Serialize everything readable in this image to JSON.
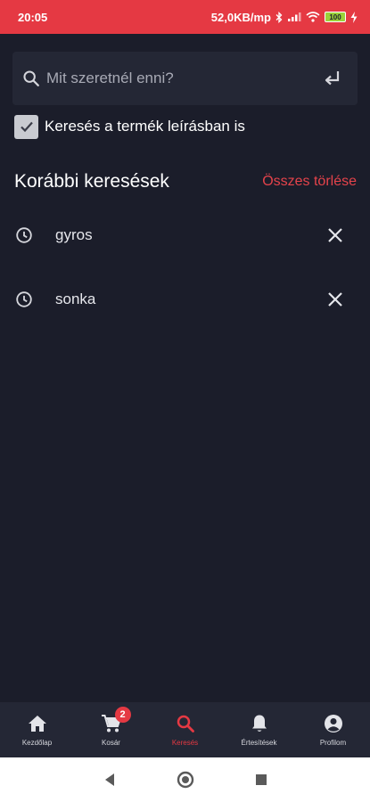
{
  "status_bar": {
    "time": "20:05",
    "network_speed": "52,0KB/mp",
    "battery_level": "100",
    "icons": [
      "bluetooth-icon",
      "signal-icon",
      "wifi-icon",
      "battery-icon",
      "charging-icon"
    ]
  },
  "search": {
    "placeholder": "Mit szeretnél enni?",
    "value": ""
  },
  "description_search": {
    "label": "Keresés a termék leírásban is",
    "checked": true
  },
  "history": {
    "title": "Korábbi keresések",
    "clear_all_label": "Összes törlése",
    "items": [
      {
        "text": "gyros"
      },
      {
        "text": "sonka"
      }
    ]
  },
  "bottom_nav": {
    "active": "search",
    "items": [
      {
        "key": "home",
        "label": "Kezdőlap",
        "icon": "home-icon"
      },
      {
        "key": "cart",
        "label": "Kosár",
        "icon": "cart-icon",
        "badge": "2"
      },
      {
        "key": "search",
        "label": "Keresés",
        "icon": "search-icon"
      },
      {
        "key": "notifications",
        "label": "Értesítések",
        "icon": "bell-icon"
      },
      {
        "key": "profile",
        "label": "Profilom",
        "icon": "profile-icon"
      }
    ]
  },
  "colors": {
    "accent": "#e53943",
    "background": "#1b1d2a",
    "surface": "#242735"
  }
}
